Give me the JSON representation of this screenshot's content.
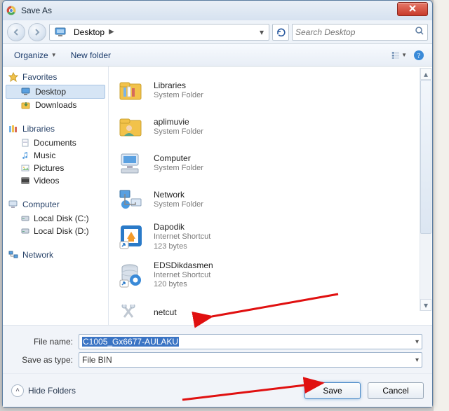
{
  "window": {
    "title": "Save As"
  },
  "breadcrumb": {
    "location": "Desktop"
  },
  "search": {
    "placeholder": "Search Desktop"
  },
  "toolbar": {
    "organize": "Organize",
    "newfolder": "New folder"
  },
  "sidebar": {
    "favorites": {
      "label": "Favorites",
      "items": [
        "Desktop",
        "Downloads"
      ]
    },
    "libraries": {
      "label": "Libraries",
      "items": [
        "Documents",
        "Music",
        "Pictures",
        "Videos"
      ]
    },
    "computer": {
      "label": "Computer",
      "items": [
        "Local Disk (C:)",
        "Local Disk (D:)"
      ]
    },
    "network": {
      "label": "Network"
    }
  },
  "files": [
    {
      "name": "Libraries",
      "sub": "System Folder",
      "icon": "libraries"
    },
    {
      "name": "aplimuvie",
      "sub": "System Folder",
      "icon": "userfolder"
    },
    {
      "name": "Computer",
      "sub": "System Folder",
      "icon": "computer"
    },
    {
      "name": "Network",
      "sub": "System Folder",
      "icon": "network"
    },
    {
      "name": "Dapodik",
      "sub": "Internet Shortcut",
      "sub2": "123 bytes",
      "icon": "ishortcut"
    },
    {
      "name": "EDSDikdasmen",
      "sub": "Internet Shortcut",
      "sub2": "120 bytes",
      "icon": "dbshortcut"
    },
    {
      "name": "netcut",
      "sub": "",
      "icon": "netcut"
    }
  ],
  "form": {
    "filename_label": "File name:",
    "filename_value": "C1005_Gx6677-AULAKU",
    "type_label": "Save as type:",
    "type_value": "File BIN"
  },
  "footer": {
    "hide": "Hide Folders",
    "save": "Save",
    "cancel": "Cancel"
  }
}
